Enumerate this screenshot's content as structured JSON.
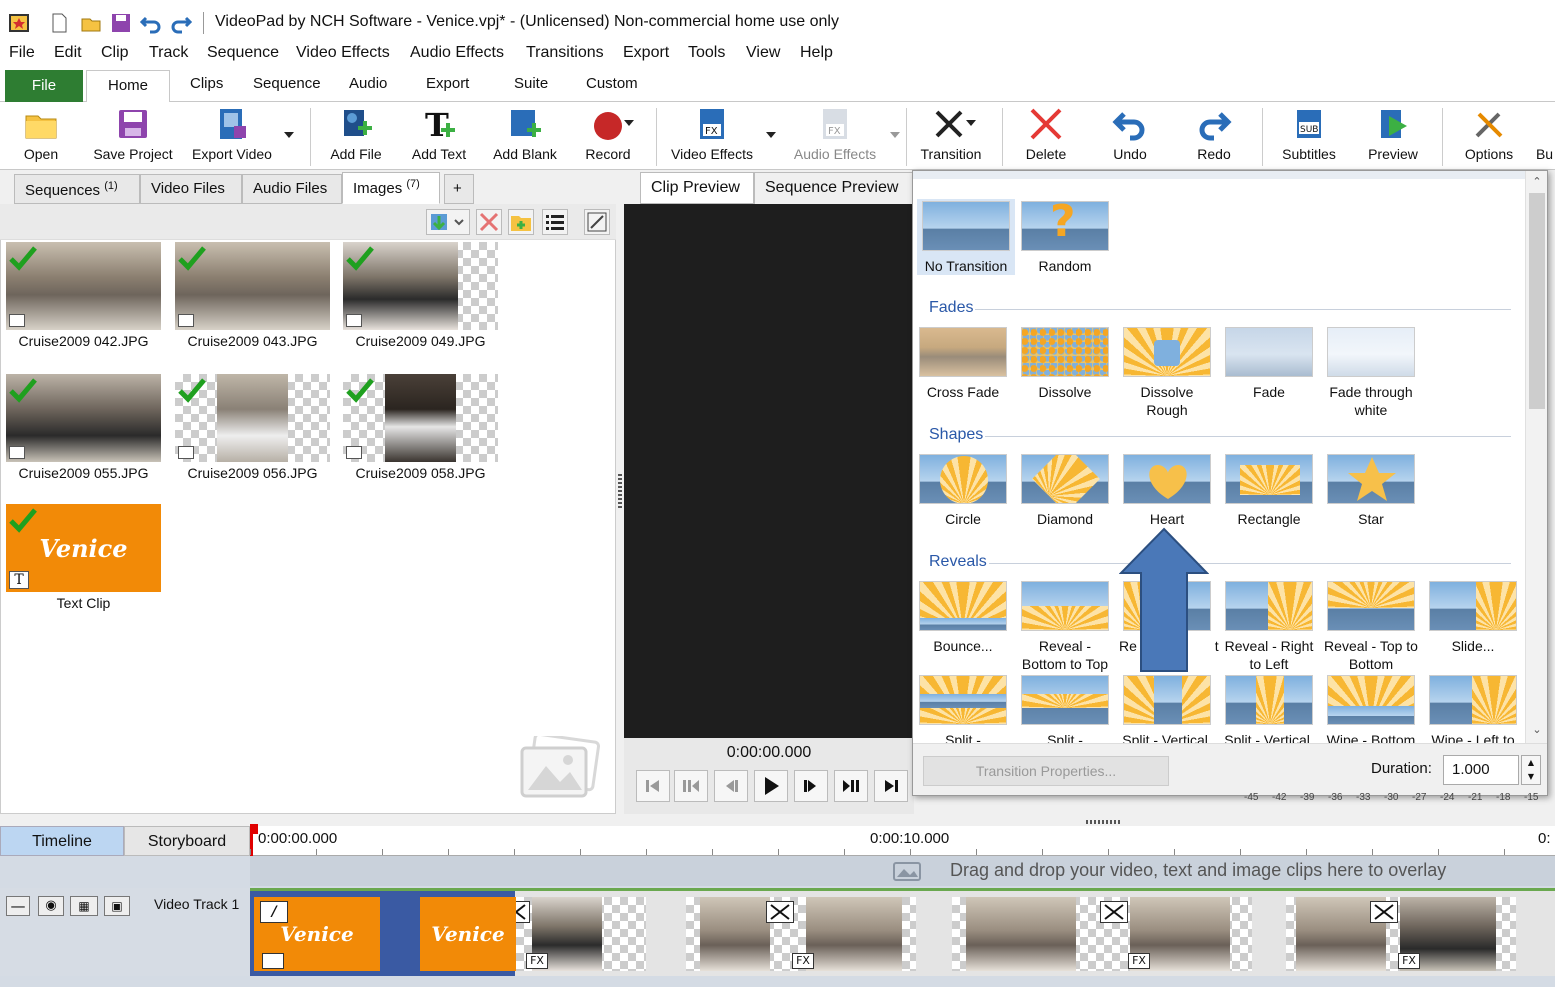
{
  "window": {
    "title": "VideoPad by NCH Software - Venice.vpj* - (Unlicensed) Non-commercial home use only"
  },
  "menu": [
    "File",
    "Edit",
    "Clip",
    "Track",
    "Sequence",
    "Video Effects",
    "Audio Effects",
    "Transitions",
    "Export",
    "Tools",
    "View",
    "Help"
  ],
  "ribbon_tabs": {
    "file": "File",
    "home": "Home",
    "clips": "Clips",
    "sequence": "Sequence",
    "audio": "Audio",
    "export": "Export",
    "suite": "Suite",
    "custom": "Custom"
  },
  "toolbar": {
    "open": "Open",
    "save_project": "Save Project",
    "export_video": "Export Video",
    "add_file": "Add File",
    "add_text": "Add Text",
    "add_blank": "Add Blank",
    "record": "Record",
    "video_effects": "Video Effects",
    "audio_effects": "Audio Effects",
    "transition": "Transition",
    "delete": "Delete",
    "undo": "Undo",
    "redo": "Redo",
    "subtitles": "Subtitles",
    "preview": "Preview",
    "options": "Options",
    "buy": "Bu"
  },
  "bins": {
    "tabs": [
      {
        "label": "Sequences",
        "count": "(1)"
      },
      {
        "label": "Video Files",
        "count": ""
      },
      {
        "label": "Audio Files",
        "count": ""
      },
      {
        "label": "Images",
        "count": "(7)"
      },
      {
        "label": "+",
        "count": ""
      }
    ],
    "items": [
      {
        "name": "Cruise2009 042.JPG"
      },
      {
        "name": "Cruise2009 043.JPG"
      },
      {
        "name": "Cruise2009 049.JPG"
      },
      {
        "name": "Cruise2009 055.JPG"
      },
      {
        "name": "Cruise2009 056.JPG"
      },
      {
        "name": "Cruise2009 058.JPG"
      },
      {
        "name": "Text Clip",
        "text": "Venice"
      }
    ]
  },
  "preview": {
    "clip_tab": "Clip Preview",
    "sequence_tab": "Sequence Preview",
    "timecode": "0:00:00.000"
  },
  "transitions": {
    "top": [
      {
        "label": "No Transition"
      },
      {
        "label": "Random"
      }
    ],
    "fades_title": "Fades",
    "fades": [
      "Cross Fade",
      "Dissolve",
      "Dissolve Rough",
      "Fade",
      "Fade through white"
    ],
    "shapes_title": "Shapes",
    "shapes": [
      "Circle",
      "Diamond",
      "Heart",
      "Rectangle",
      "Star"
    ],
    "reveals_title": "Reveals",
    "reveals": [
      "Bounce...",
      "Reveal - Bottom to Top",
      "Re      Left        t",
      "Reveal - Right to Left",
      "Reveal - Top to Bottom",
      "Slide..."
    ],
    "splits": [
      "Split -",
      "Split -",
      "Split - Vertical,",
      "Split - Vertical,",
      "Wipe - Bottom",
      "Wipe - Left to"
    ],
    "properties_button": "Transition Properties...",
    "duration_label": "Duration:",
    "duration_value": "1.000",
    "scale": [
      "-45",
      "-42",
      "-39",
      "-36",
      "-33",
      "-30",
      "-27",
      "-24",
      "-21",
      "-18",
      "-15"
    ]
  },
  "timeline": {
    "timeline_tab": "Timeline",
    "storyboard_tab": "Storyboard",
    "ruler": [
      "0:00:00.000",
      "0:00:10.000",
      "0:"
    ],
    "overlay_hint": "Drag and drop your video, text and image clips here to overlay",
    "video_track": "Video Track 1",
    "clip_text": "Venice",
    "fx": "FX"
  },
  "colors": {
    "accent": "#2e7d32",
    "venice": "#f28a07",
    "section": "#2a58a8",
    "arrow": "#4a78b8"
  }
}
